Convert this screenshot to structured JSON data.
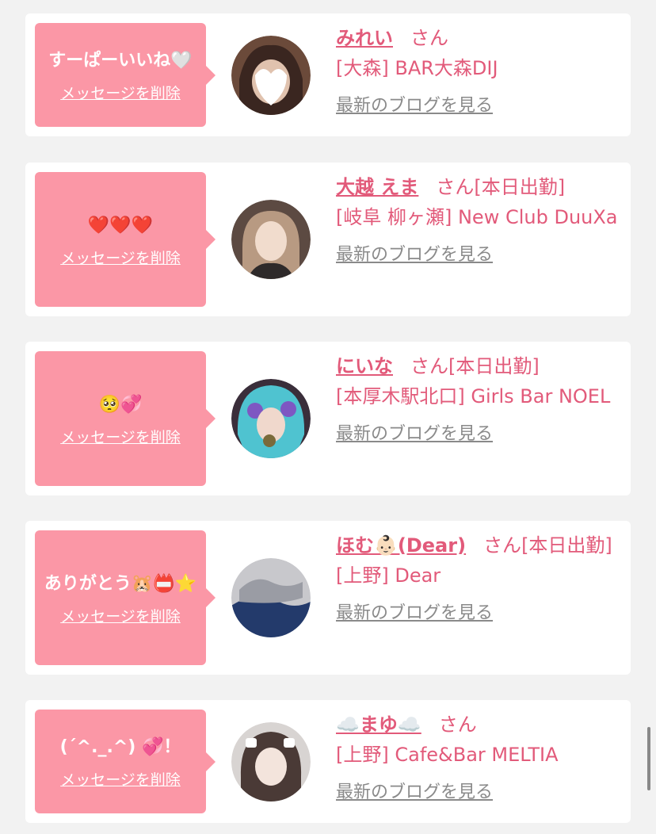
{
  "cards": [
    {
      "message": "すーぱーいいね🤍",
      "delete_label": "メッセージを削除",
      "name": "みれい",
      "honorific": "さん",
      "status": "",
      "shop": "[大森] BAR大森DIJ",
      "blog_link": "最新のブログを見る"
    },
    {
      "message": "❤️❤️❤️",
      "delete_label": "メッセージを削除",
      "name": "大越 えま",
      "honorific": "さん",
      "status": "[本日出勤]",
      "shop": "[岐阜 柳ヶ瀬] New Club DuuXa",
      "blog_link": "最新のブログを見る"
    },
    {
      "message": "🥺💞",
      "delete_label": "メッセージを削除",
      "name": "にいな",
      "honorific": "さん",
      "status": "[本日出勤]",
      "shop": "[本厚木駅北口] Girls Bar NOEL",
      "blog_link": "最新のブログを見る"
    },
    {
      "message": "ありがとう🐹📛⭐️",
      "delete_label": "メッセージを削除",
      "name": "ほむ👶🏻(Dear)",
      "honorific": "さん",
      "status": "[本日出勤]",
      "shop": "[上野] Dear",
      "blog_link": "最新のブログを見る"
    },
    {
      "message": "(ˊ^._.^) 💞！",
      "delete_label": "メッセージを削除",
      "name": "☁️まゆ☁️",
      "honorific": "さん",
      "status": "",
      "shop": "[上野] Cafe&Bar MELTIA",
      "blog_link": "最新のブログを見る"
    }
  ],
  "colors": {
    "bubble": "#fb97a6",
    "accent_text": "#e25a7a",
    "link_gray": "#8a8a8a",
    "background": "#f2f2f2"
  }
}
